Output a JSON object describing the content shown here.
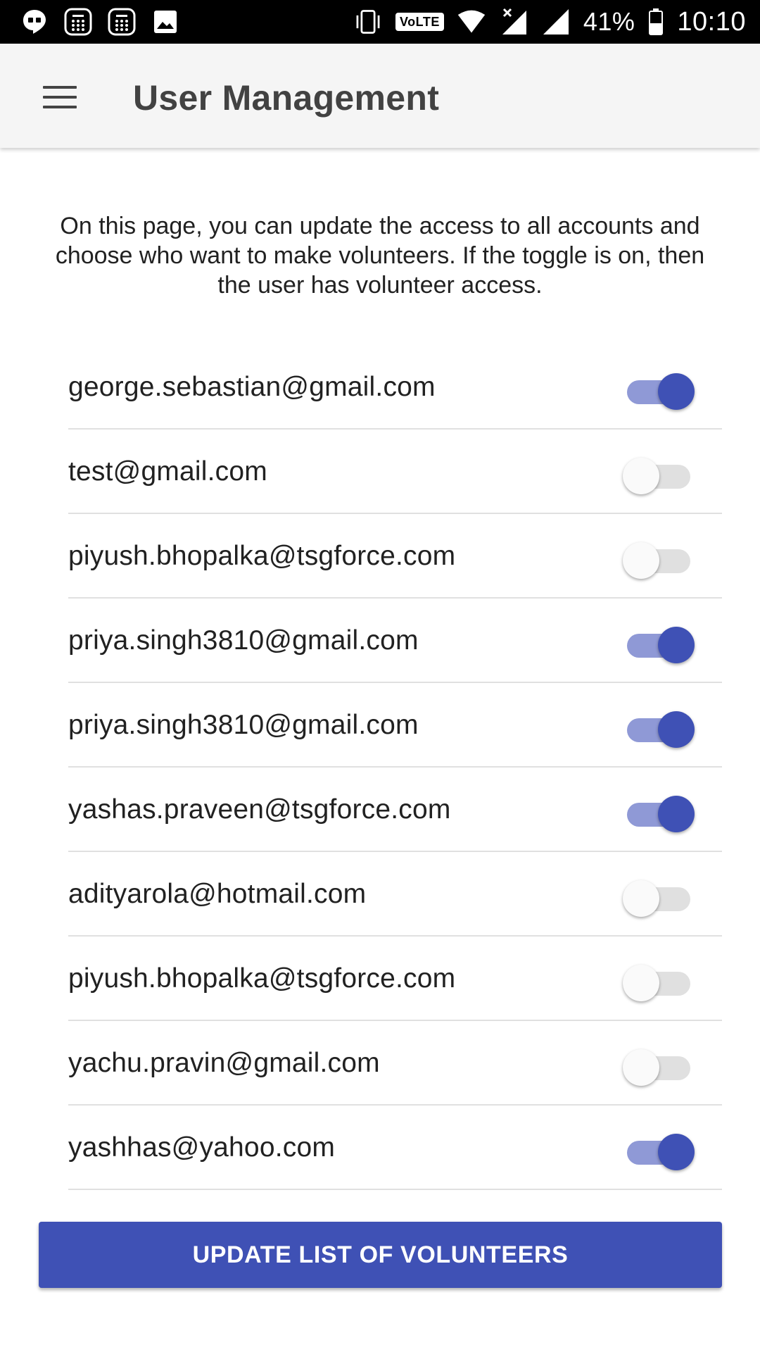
{
  "status_bar": {
    "left_icons": [
      "hangouts-icon",
      "calculator-icon",
      "calculator-icon",
      "image-icon"
    ],
    "volte_label": "VoLTE",
    "battery_percent": "41%",
    "time": "10:10"
  },
  "app_bar": {
    "title": "User Management",
    "menu_icon": "hamburger-menu-icon"
  },
  "description": "On this page, you can update the access to all accounts and choose who want to make volunteers. If the toggle is on, then the user has volunteer access.",
  "users": [
    {
      "email": "george.sebastian@gmail.com",
      "volunteer": true
    },
    {
      "email": "test@gmail.com",
      "volunteer": false
    },
    {
      "email": "piyush.bhopalka@tsgforce.com",
      "volunteer": false
    },
    {
      "email": "priya.singh3810@gmail.com",
      "volunteer": true
    },
    {
      "email": "priya.singh3810@gmail.com",
      "volunteer": true
    },
    {
      "email": "yashas.praveen@tsgforce.com",
      "volunteer": true
    },
    {
      "email": "adityarola@hotmail.com",
      "volunteer": false
    },
    {
      "email": "piyush.bhopalka@tsgforce.com",
      "volunteer": false
    },
    {
      "email": "yachu.pravin@gmail.com",
      "volunteer": false
    },
    {
      "email": "yashhas@yahoo.com",
      "volunteer": true
    }
  ],
  "update_button_label": "UPDATE LIST OF VOLUNTEERS",
  "colors": {
    "primary": "#3f51b5",
    "toggle_track_on": "#8f99d6",
    "toggle_track_off": "#e0e0e0",
    "app_bar_bg": "#f5f5f5"
  }
}
